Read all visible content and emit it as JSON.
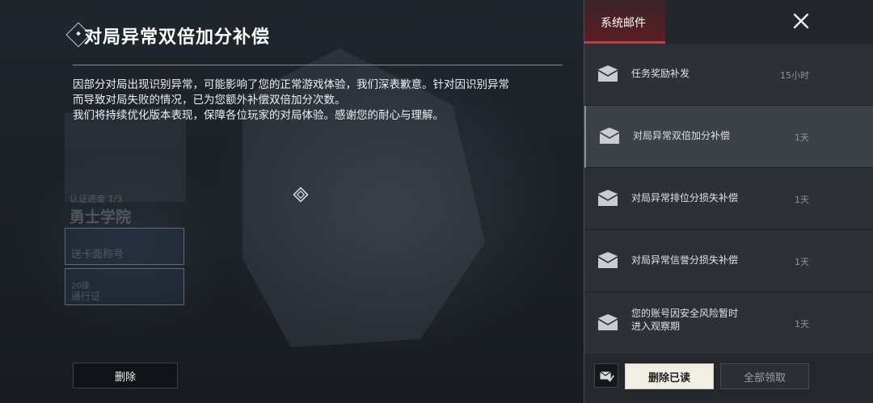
{
  "detail": {
    "title": "对局异常双倍加分补偿",
    "body_lines": [
      "因部分对局出现识别异常，可能影响了您的正常游戏体验，我们深表歉意。针对因识别异常",
      "而导致对局失败的情况，已为您额外补偿双倍加分次数。",
      "我们将持续优化版本表现，保障各位玩家的对局体验。感谢您的耐心与理解。"
    ],
    "delete_label": "删除"
  },
  "background": {
    "academy_progress": "认证进度  1/3",
    "academy_name": "勇士学院",
    "card_title": "送卡面称号",
    "pass_level": "20级",
    "pass_label": "通行证"
  },
  "mail_panel": {
    "tab_label": "系统邮件",
    "close_icon": "close-icon",
    "items": [
      {
        "subject": "任务奖励补发",
        "age": "15小时",
        "selected": false
      },
      {
        "subject": "对局异常双倍加分补偿",
        "age": "1天",
        "selected": true
      },
      {
        "subject": "对局异常排位分损失补偿",
        "age": "1天",
        "selected": false
      },
      {
        "subject": "对局异常信誉分损失补偿",
        "age": "1天",
        "selected": false
      },
      {
        "subject": "您的账号因安全风险暂时进入观察期",
        "age": "1天",
        "selected": false
      }
    ],
    "delete_read_label": "删除已读",
    "claim_all_label": "全部领取"
  },
  "colors": {
    "accent_red": "#e0323c",
    "primary_button_bg": "#f3eee4"
  }
}
